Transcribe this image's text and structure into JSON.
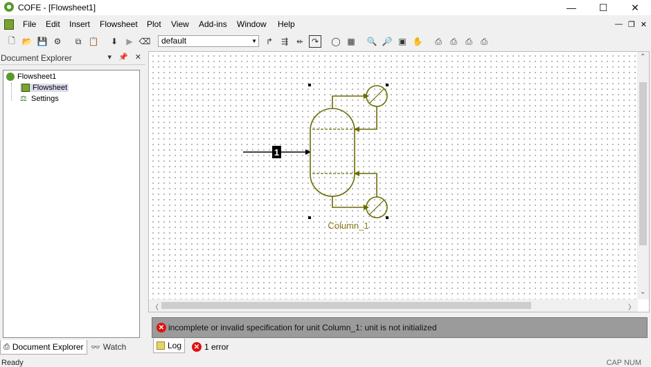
{
  "window": {
    "title": "COFE - [Flowsheet1]"
  },
  "menu": {
    "items": [
      "File",
      "Edit",
      "Insert",
      "Flowsheet",
      "Plot",
      "View",
      "Add-ins",
      "Window",
      "Help"
    ]
  },
  "toolbar": {
    "zoom_value": "default"
  },
  "doc_explorer": {
    "title": "Document Explorer",
    "tree": {
      "root": "Flowsheet1",
      "children": [
        "Flowsheet",
        "Settings"
      ]
    }
  },
  "bottom_tabs": {
    "doc_explorer": "Document Explorer",
    "watch": "Watch"
  },
  "canvas": {
    "stream_label": "1",
    "unit_label": "Column_1",
    "accent": "#6b6b00"
  },
  "messages": {
    "error_text": "incomplete or invalid specification for unit Column_1: unit is not initialized",
    "tab_log": "Log",
    "tab_errors": "1 error"
  },
  "status": {
    "left": "Ready",
    "right": "CAP NUM"
  },
  "icons": [
    "app-icon",
    "minimize-icon",
    "maximize-icon",
    "close-icon",
    "new-icon",
    "open-icon",
    "save-icon",
    "error-icon",
    "log-icon",
    "watch-icon"
  ]
}
